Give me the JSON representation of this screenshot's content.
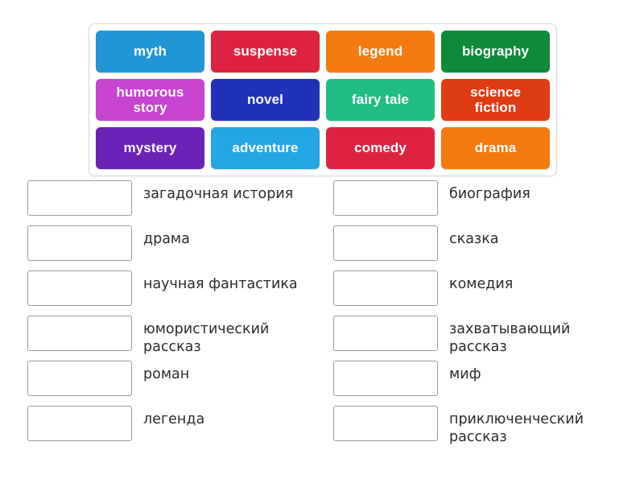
{
  "word_bank": {
    "name": "word-bank",
    "rows": [
      [
        {
          "label": "myth",
          "color": "#2196d6"
        },
        {
          "label": "suspense",
          "color": "#de2342"
        },
        {
          "label": "legend",
          "color": "#f47b10"
        },
        {
          "label": "biography",
          "color": "#0f8a3c"
        }
      ],
      [
        {
          "label": "humorous\nstory",
          "color": "#c644cf"
        },
        {
          "label": "novel",
          "color": "#2032b8"
        },
        {
          "label": "fairy tale",
          "color": "#21bd84"
        },
        {
          "label": "science\nfiction",
          "color": "#e03c14"
        }
      ],
      [
        {
          "label": "mystery",
          "color": "#6a21b5"
        },
        {
          "label": "adventure",
          "color": "#25a6e4"
        },
        {
          "label": "comedy",
          "color": "#de2342"
        },
        {
          "label": "drama",
          "color": "#f47b10"
        }
      ]
    ]
  },
  "answers": {
    "left_column": [
      {
        "slot_value": "",
        "label": "загадочная история"
      },
      {
        "slot_value": "",
        "label": "драма"
      },
      {
        "slot_value": "",
        "label": "научная фантастика"
      },
      {
        "slot_value": "",
        "label": "юмористический\nрассказ"
      },
      {
        "slot_value": "",
        "label": "роман"
      },
      {
        "slot_value": "",
        "label": "легенда"
      }
    ],
    "right_column": [
      {
        "slot_value": "",
        "label": "биография"
      },
      {
        "slot_value": "",
        "label": "сказка"
      },
      {
        "slot_value": "",
        "label": "комедия"
      },
      {
        "slot_value": "",
        "label": "захватывающий\nрассказ"
      },
      {
        "slot_value": "",
        "label": "миф"
      },
      {
        "slot_value": "",
        "label": "приключенческий\nрассказ"
      }
    ]
  }
}
